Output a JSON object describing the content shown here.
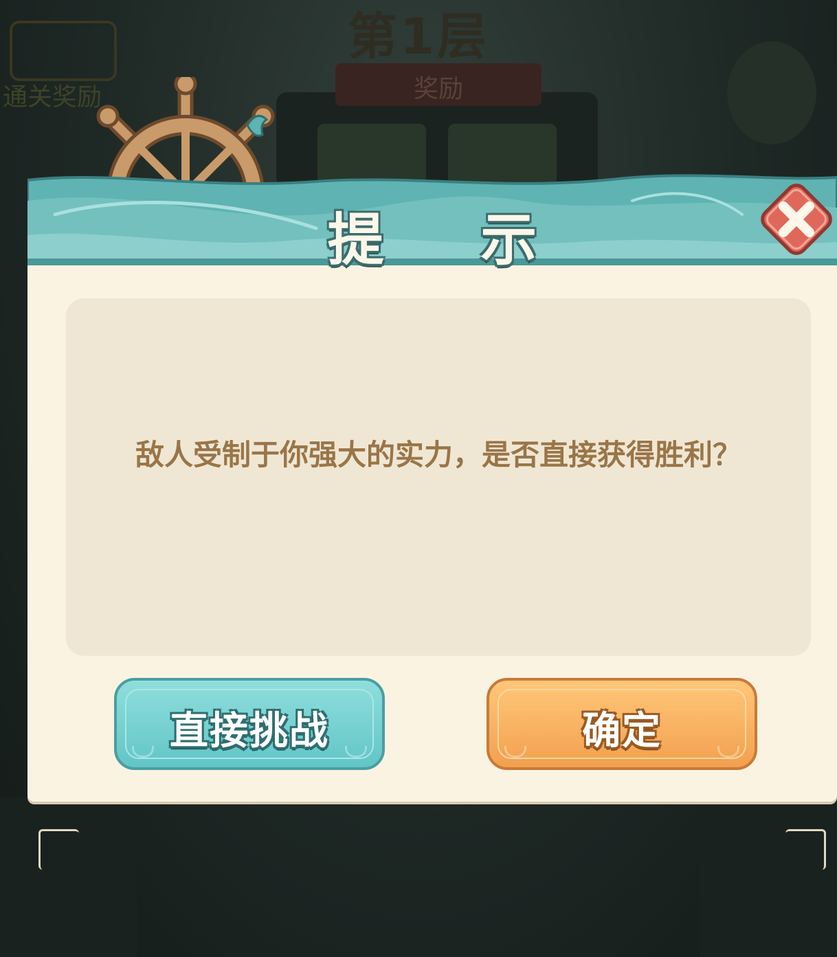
{
  "background": {
    "floor_title": "第1层",
    "reward_ribbon_label": "奖励",
    "clear_reward_label": "通关奖励"
  },
  "dialog": {
    "title": "提 示",
    "message": "敌人受制于你强大的实力，是否直接获得胜利？",
    "close_icon": "close-x-icon",
    "decoration_icon": "ship-helm-wheel-icon",
    "buttons": {
      "challenge_label": "直接挑战",
      "confirm_label": "确定"
    }
  },
  "colors": {
    "header_teal": "#5fb3b3",
    "body_cream": "#fbf3e2",
    "message_text": "#9a7548",
    "challenge_button": "#6fcfcf",
    "confirm_button": "#f5ad5c",
    "close_button": "#e0685a"
  }
}
